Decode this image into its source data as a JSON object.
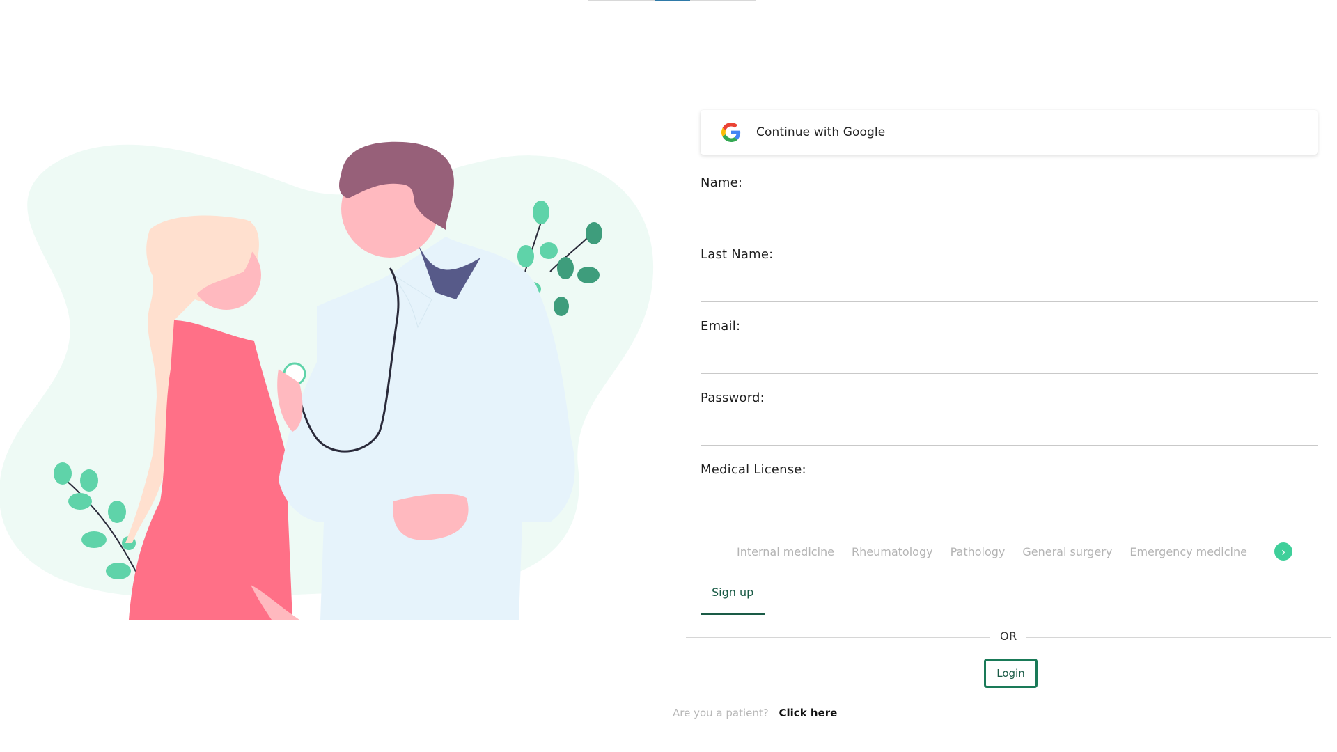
{
  "form": {
    "google_label": "Continue with Google",
    "fields": [
      {
        "label": "Name:",
        "value": ""
      },
      {
        "label": "Last Name:",
        "value": ""
      },
      {
        "label": "Email:",
        "value": ""
      },
      {
        "label": "Password:",
        "value": ""
      },
      {
        "label": "Medical License:",
        "value": ""
      }
    ],
    "specialties": [
      "Internal medicine",
      "Rheumatology",
      "Pathology",
      "General surgery",
      "Emergency medicine"
    ],
    "next_icon": "chevron-right-icon"
  },
  "tabs": {
    "signup_label": "Sign up"
  },
  "or_label": "OR",
  "login_label": "Login",
  "patient": {
    "question": "Are you a patient?",
    "link": "Click here"
  },
  "colors": {
    "accent": "#1a7a58",
    "accent_text": "#1a5b46",
    "chip_next": "#3fcf9a",
    "blob": "#eefaf5"
  }
}
